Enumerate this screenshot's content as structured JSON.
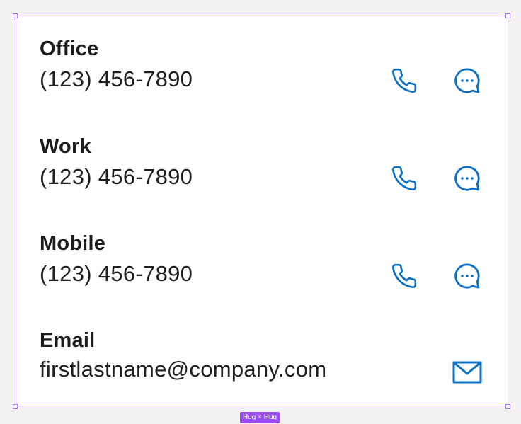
{
  "contacts": [
    {
      "label": "Office",
      "value": "(123) 456-7890",
      "actions": [
        "phone-icon",
        "chat-icon"
      ]
    },
    {
      "label": "Work",
      "value": "(123) 456-7890",
      "actions": [
        "phone-icon",
        "chat-icon"
      ]
    },
    {
      "label": "Mobile",
      "value": "(123) 456-7890",
      "actions": [
        "phone-icon",
        "chat-icon"
      ]
    },
    {
      "label": "Email",
      "value": "firstlastname@company.com",
      "actions": [
        "mail-icon"
      ]
    }
  ],
  "frame_badge": "Hug × Hug",
  "colors": {
    "icon": "#0b6fc6",
    "text": "#1c1c1c",
    "selection": "#a26ee6",
    "badge": "#9a4cf0"
  }
}
